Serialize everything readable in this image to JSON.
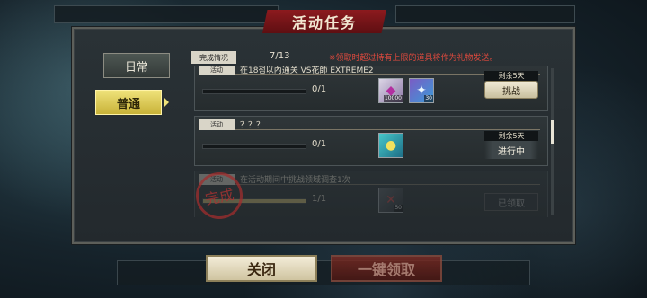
{
  "header": {
    "title": "活动任务"
  },
  "tabs": [
    {
      "label": "日常",
      "selected": false
    },
    {
      "label": "普通",
      "selected": true
    }
  ],
  "summary": {
    "label": "完成情况",
    "value": "7/13",
    "notice": "※领取时超过持有上限的道具将作为礼物发送。"
  },
  "tasks": [
    {
      "tag": "活动",
      "title": "在18점以內通关 VS花師 EXTREME2",
      "count": "0/1",
      "progress": 0,
      "days_left": "剩余5天",
      "action": "挑战",
      "rewards": [
        {
          "icon": "gem-pack-icon",
          "qty": "10000"
        },
        {
          "icon": "crystal-icon",
          "qty": "30"
        }
      ]
    },
    {
      "tag": "活动",
      "title": "？？？",
      "count": "0/1",
      "progress": 0,
      "days_left": "剩余5天",
      "action": "进行中",
      "rewards": [
        {
          "icon": "key-item-icon",
          "qty": ""
        }
      ]
    },
    {
      "tag": "活动",
      "title": "在活动期间中挑战领域调查1次",
      "count": "1/1",
      "progress": 1,
      "days_left": "",
      "action": "已领取",
      "rewards": [
        {
          "icon": "material-icon",
          "qty": "50"
        }
      ]
    }
  ],
  "stamp": {
    "text": "完成"
  },
  "footer": {
    "close_label": "关闭",
    "claim_all_label": "一键领取"
  },
  "colors": {
    "accent_gold": "#efe27a",
    "banner_red": "#8c1a1e",
    "notice_red": "#e24a3e"
  }
}
